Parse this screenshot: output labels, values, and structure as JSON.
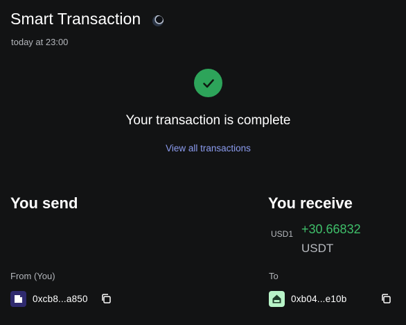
{
  "header": {
    "title": "Smart Transaction",
    "timestamp": "today at 23:00",
    "network_icon": "network-globe-icon"
  },
  "status": {
    "icon": "checkmark-icon",
    "message": "Your transaction is complete",
    "link": "View all transactions"
  },
  "send": {
    "heading": "You send",
    "party_label": "From (You)",
    "address": "0xcb8...a850",
    "avatar_icon": "account-avatar-icon",
    "copy_icon": "copy-icon"
  },
  "receive": {
    "heading": "You receive",
    "token_label": "USD1",
    "amount": "+30.66832",
    "currency": "USDT",
    "party_label": "To",
    "address": "0xb04...e10b",
    "avatar_icon": "account-avatar-icon",
    "copy_icon": "copy-icon"
  },
  "colors": {
    "background": "#121314",
    "success": "#2da45a",
    "amount_positive": "#3fbf6a",
    "link": "#8c9cf0",
    "muted_text": "#b3b6bb"
  }
}
